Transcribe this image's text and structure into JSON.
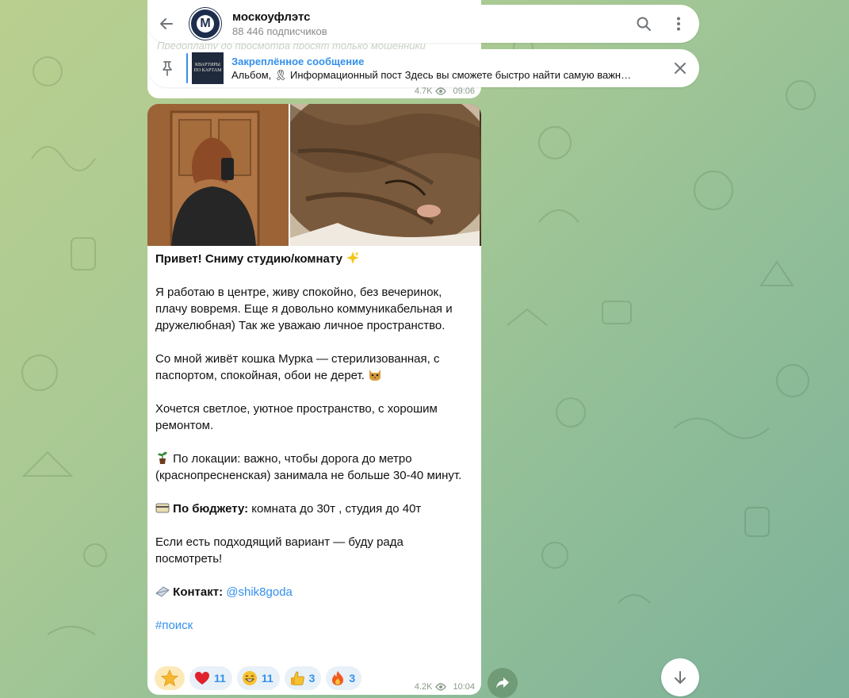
{
  "channel": {
    "name": "москоуфлэтс",
    "subscribers": "88 446 подписчиков",
    "avatar_letter": "M"
  },
  "prev_message": {
    "ghost_text": "Предоплату до просмотра просят только мошенники",
    "views": "4.7K",
    "time": "09:06"
  },
  "pinned": {
    "title": "Закреплённое сообщение",
    "body": "Альбом, 🎗 Информационный пост Здесь вы сможете быстро найти самую важн…",
    "thumb_text": "КВАРТИРЫ ПО КАРТАМ"
  },
  "message": {
    "heading": "Привет! Сниму студию/комнату",
    "p1": "Я работаю в центре, живу спокойно, без вечеринок, плачу вовремя. Еще я довольно коммуникабельная и дружелюбная) Так же уважаю личное пространство.",
    "p2": "Со мной живёт кошка Мурка — стерилизованная, с паспортом, спокойная, обои не дерет.",
    "p3": "Хочется светлое, уютное пространство, с хорошим ремонтом.",
    "p4": "По локации: важно, чтобы дорога до метро (краснопресненская) занимала не больше 30-40 минут.",
    "budget_label": "По бюджету:",
    "budget_value": " комната до 30т , студия до 40т",
    "p6": "Если есть подходящий вариант — буду рада посмотреть!",
    "contact_label": "Контакт:",
    "contact_link": "@shik8goda",
    "hashtag": "#поиск",
    "views": "4.2K",
    "time": "10:04"
  },
  "reactions": [
    {
      "emoji": "star",
      "count": ""
    },
    {
      "emoji": "heart",
      "count": "11"
    },
    {
      "emoji": "grin",
      "count": "11"
    },
    {
      "emoji": "thumbs-up",
      "count": "3"
    },
    {
      "emoji": "fire",
      "count": "3"
    }
  ],
  "colors": {
    "accent": "#3390ec",
    "bubble": "#ffffff"
  }
}
